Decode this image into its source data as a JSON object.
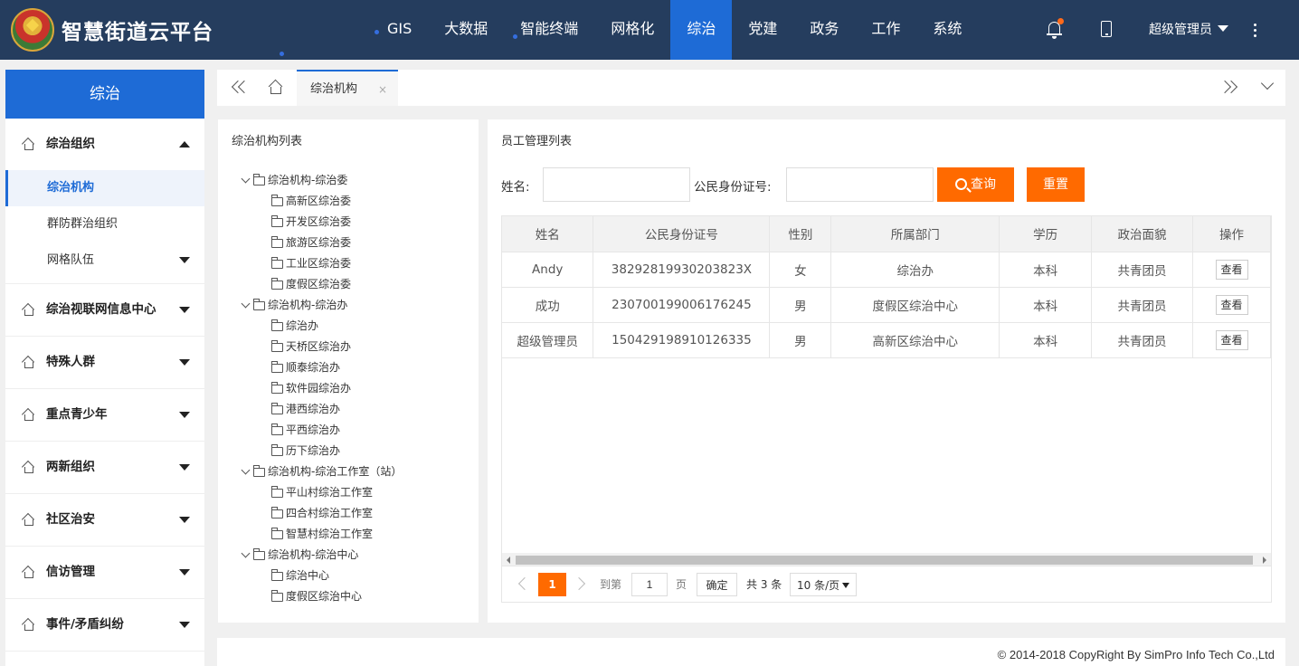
{
  "brand": {
    "title": "智慧街道云平台"
  },
  "nav": {
    "items": [
      "GIS",
      "大数据",
      "智能终端",
      "网格化",
      "综治",
      "党建",
      "政务",
      "工作",
      "系统"
    ],
    "active": "综治",
    "user": "超级管理员"
  },
  "sidebar": {
    "header": "综治",
    "groups": [
      {
        "title": "综治组织",
        "expanded": true,
        "items": [
          "综治机构",
          "群防群治组织",
          "网格队伍"
        ],
        "active_item": "综治机构"
      },
      {
        "title": "综治视联网信息中心"
      },
      {
        "title": "特殊人群"
      },
      {
        "title": "重点青少年"
      },
      {
        "title": "两新组织"
      },
      {
        "title": "社区治安"
      },
      {
        "title": "信访管理"
      },
      {
        "title": "事件/矛盾纠纷"
      }
    ]
  },
  "tabs": {
    "items": [
      {
        "label": "综治机构",
        "close": "×"
      }
    ]
  },
  "tree": {
    "title": "综治机构列表",
    "nodes": [
      {
        "label": "综治机构-综治委",
        "children": [
          "高新区综治委",
          "开发区综治委",
          "旅游区综治委",
          "工业区综治委",
          "度假区综治委"
        ]
      },
      {
        "label": "综治机构-综治办",
        "children": [
          "综治办",
          "天桥区综治办",
          "顺泰综治办",
          "软件园综治办",
          "港西综治办",
          "平西综治办",
          "历下综治办"
        ]
      },
      {
        "label": "综治机构-综治工作室（站）",
        "children": [
          "平山村综治工作室",
          "四合村综治工作室",
          "智慧村综治工作室"
        ]
      },
      {
        "label": "综治机构-综治中心",
        "children": [
          "综治中心",
          "度假区综治中心"
        ]
      }
    ]
  },
  "main": {
    "title": "员工管理列表",
    "search": {
      "name_label": "姓名:",
      "id_label": "公民身份证号:",
      "name_value": "",
      "id_value": "",
      "query_label": "查询",
      "reset_label": "重置"
    },
    "table": {
      "columns": [
        "姓名",
        "公民身份证号",
        "性别",
        "所属部门",
        "学历",
        "政治面貌",
        "操作"
      ],
      "rows": [
        [
          "Andy",
          "38292819930203823X",
          "女",
          "综治办",
          "本科",
          "共青团员"
        ],
        [
          "成功",
          "230700199006176245",
          "男",
          "度假区综治中心",
          "本科",
          "共青团员"
        ],
        [
          "超级管理员",
          "150429198910126335",
          "男",
          "高新区综治中心",
          "本科",
          "共青团员"
        ]
      ],
      "action_label": "查看"
    },
    "pager": {
      "current_page": "1",
      "goto_label": "到第",
      "goto_value": "1",
      "page_unit": "页",
      "confirm_label": "确定",
      "total_label": "共 3 条",
      "page_size": "10 条/页"
    }
  },
  "footer": {
    "copyright": "© 2014-2018 CopyRight By SimPro Info Tech Co.,Ltd"
  },
  "colors": {
    "topbar": "#253d5e",
    "accent_blue": "#1e6bd6",
    "accent_orange": "#ff6a00"
  }
}
